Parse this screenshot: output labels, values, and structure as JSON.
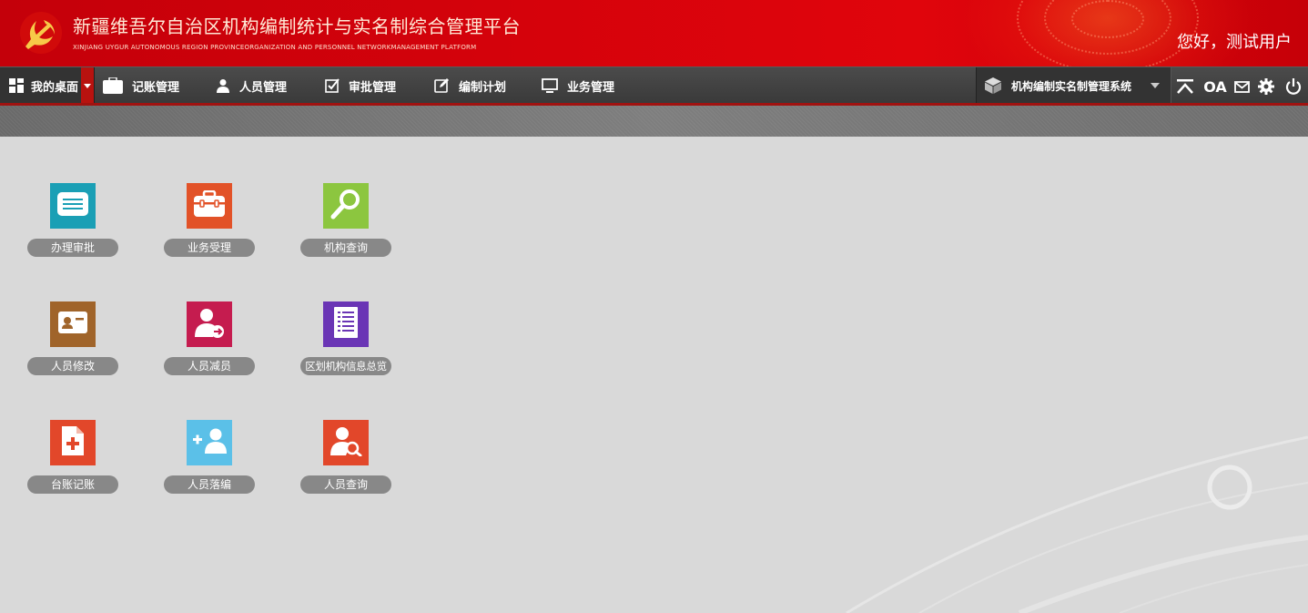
{
  "header": {
    "title_cn": "新疆维吾尔自治区机构编制统计与实名制综合管理平台",
    "title_en": "XINJIANG UYGUR AUTONOMOUS REGION PROVINCEORGANIZATION AND PERSONNEL NETWORKMANAGEMENT PLATFORM",
    "greeting": "您好，测试用户"
  },
  "nav": {
    "home": "我的桌面",
    "items": [
      {
        "label": "记账管理",
        "icon": "briefcase-icon"
      },
      {
        "label": "人员管理",
        "icon": "user-icon"
      },
      {
        "label": "审批管理",
        "icon": "checkbox-icon"
      },
      {
        "label": "编制计划",
        "icon": "edit-icon"
      },
      {
        "label": "业务管理",
        "icon": "monitor-icon"
      }
    ],
    "system_select": "机构编制实名制管理系统",
    "tools": [
      "collapse-top-icon",
      "oa-icon",
      "mail-icon",
      "gear-icon",
      "power-icon"
    ],
    "oa_text": "OA"
  },
  "colors": {
    "header_red": "#d5020b",
    "nav_dark": "#3f3f3f",
    "desktop_bg": "#d9d9d9",
    "label_gray": "#888888"
  },
  "tiles": [
    {
      "label": "办理审批",
      "color": "#1a9fb5",
      "icon": "message-icon"
    },
    {
      "label": "业务受理",
      "color": "#e25228",
      "icon": "toolbox-icon"
    },
    {
      "label": "机构查询",
      "color": "#8cc63f",
      "icon": "search-icon"
    },
    {
      "label": "人员修改",
      "color": "#a0642a",
      "icon": "id-card-icon"
    },
    {
      "label": "人员减员",
      "color": "#c51c4f",
      "icon": "user-remove-icon"
    },
    {
      "label": "区划机构信息总览",
      "color": "#6a35b5",
      "icon": "document-list-icon"
    },
    {
      "label": "台账记账",
      "color": "#e2472a",
      "icon": "file-add-icon"
    },
    {
      "label": "人员落编",
      "color": "#5bc0e8",
      "icon": "user-add-icon"
    },
    {
      "label": "人员查询",
      "color": "#e2472a",
      "icon": "user-search-icon"
    }
  ]
}
